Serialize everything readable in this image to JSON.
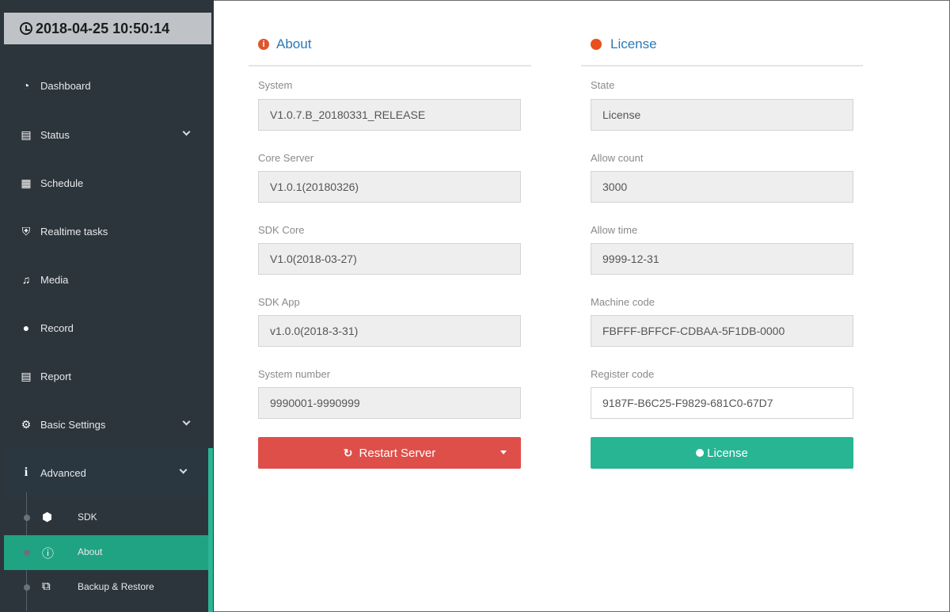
{
  "sidebar": {
    "datetime": "2018-04-25 10:50:14",
    "items": [
      {
        "label": "Dashboard",
        "icon": "dashboard-icon"
      },
      {
        "label": "Status",
        "icon": "status-icon",
        "expandable": true
      },
      {
        "label": "Schedule",
        "icon": "schedule-icon"
      },
      {
        "label": "Realtime tasks",
        "icon": "shield-icon"
      },
      {
        "label": "Media",
        "icon": "music-icon"
      },
      {
        "label": "Record",
        "icon": "microphone-icon"
      },
      {
        "label": "Report",
        "icon": "report-icon"
      },
      {
        "label": "Basic Settings",
        "icon": "gear-icon",
        "expandable": true
      },
      {
        "label": "Advanced",
        "icon": "info-icon",
        "expandable": true,
        "expanded": true
      }
    ],
    "subitems": [
      {
        "label": "SDK",
        "icon": "cube-icon",
        "active": false
      },
      {
        "label": "About",
        "icon": "info-circle-icon",
        "active": true
      },
      {
        "label": "Backup & Restore",
        "icon": "copy-icon",
        "active": false
      }
    ]
  },
  "about": {
    "title": "About",
    "fields": [
      {
        "label": "System",
        "value": "V1.0.7.B_20180331_RELEASE"
      },
      {
        "label": "Core Server",
        "value": "V1.0.1(20180326)"
      },
      {
        "label": "SDK Core",
        "value": "V1.0(2018-03-27)"
      },
      {
        "label": "SDK App",
        "value": "v1.0.0(2018-3-31)"
      },
      {
        "label": "System number",
        "value": "9990001-9990999"
      }
    ],
    "button": "Restart Server"
  },
  "license": {
    "title": "License",
    "fields": [
      {
        "label": "State",
        "value": "License"
      },
      {
        "label": "Allow count",
        "value": "3000"
      },
      {
        "label": "Allow time",
        "value": "9999-12-31"
      },
      {
        "label": "Machine code",
        "value": "FBFFF-BFFCF-CDBAA-5F1DB-0000"
      },
      {
        "label": "Register code",
        "value": "9187F-B6C25-F9829-681C0-67D7"
      }
    ],
    "button": "License"
  },
  "colors": {
    "sidebar_bg": "#2d353c",
    "accent_green": "#27b594",
    "danger_red": "#de4f4a",
    "title_blue": "#2b79b9"
  }
}
